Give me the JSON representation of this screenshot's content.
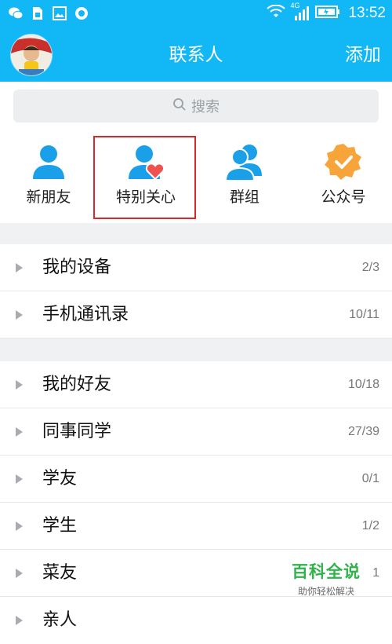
{
  "status_bar": {
    "time": "13:52",
    "network": "4G"
  },
  "header": {
    "title": "联系人",
    "add_label": "添加"
  },
  "search": {
    "placeholder": "搜索"
  },
  "quick_actions": [
    {
      "label": "新朋友",
      "icon": "person-icon"
    },
    {
      "label": "特别关心",
      "icon": "person-heart-icon"
    },
    {
      "label": "群组",
      "icon": "group-icon"
    },
    {
      "label": "公众号",
      "icon": "badge-check-icon"
    }
  ],
  "highlight_color": "#d9282a",
  "accent_color": "#12b7f5",
  "device_groups": [
    {
      "name": "我的设备",
      "count": "2/3"
    },
    {
      "name": "手机通讯录",
      "count": "10/11"
    }
  ],
  "friend_groups": [
    {
      "name": "我的好友",
      "count": "10/18"
    },
    {
      "name": "同事同学",
      "count": "27/39"
    },
    {
      "name": "学友",
      "count": "0/1"
    },
    {
      "name": "学生",
      "count": "1/2"
    },
    {
      "name": "菜友",
      "count": "1"
    },
    {
      "name": "亲人",
      "count": ""
    }
  ],
  "watermark": {
    "title": "百科全说",
    "subtitle": "助你轻松解决"
  }
}
